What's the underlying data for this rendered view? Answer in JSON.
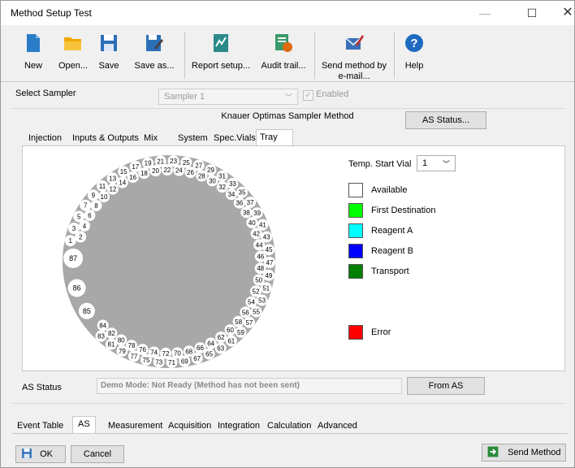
{
  "window": {
    "title": "Method Setup Test",
    "minimize": "—",
    "maximize": "☐",
    "close": "✕"
  },
  "toolbar": {
    "new": "New",
    "open": "Open...",
    "save": "Save",
    "save_as": "Save as...",
    "report_setup": "Report setup...",
    "audit_trail": "Audit trail...",
    "send_email": "Send method by e-mail...",
    "help": "Help"
  },
  "sampler": {
    "label": "Select Sampler",
    "value": "Sampler 1",
    "enabled_label": "Enabled"
  },
  "method_title": "Knauer Optimas Sampler Method",
  "as_status_button": "AS Status...",
  "tabs": [
    "Injection",
    "Inputs & Outputs",
    "Mix",
    "System",
    "Spec.Vials",
    "Tray"
  ],
  "tray": {
    "temp_start_label": "Temp. Start Vial",
    "temp_start_value": "1",
    "legend": [
      {
        "label": "Available",
        "color": "#ffffff"
      },
      {
        "label": "First Destination",
        "color": "#00ff00"
      },
      {
        "label": "Reagent A",
        "color": "#00ffff"
      },
      {
        "label": "Reagent B",
        "color": "#0000ff"
      },
      {
        "label": "Transport",
        "color": "#007f00"
      },
      {
        "label": "Error",
        "color": "#ff0000"
      }
    ],
    "vials": [
      "1",
      "2",
      "3",
      "4",
      "5",
      "6",
      "7",
      "8",
      "9",
      "10",
      "11",
      "12",
      "13",
      "14",
      "15",
      "16",
      "17",
      "18",
      "19",
      "20",
      "21",
      "22",
      "23",
      "24",
      "25",
      "26",
      "27",
      "28",
      "29",
      "30",
      "31",
      "32",
      "33",
      "34",
      "35",
      "36",
      "37",
      "38",
      "39",
      "40",
      "41",
      "42",
      "43",
      "44",
      "45",
      "46",
      "47",
      "48",
      "49",
      "50",
      "51",
      "52",
      "53",
      "54",
      "55",
      "56",
      "57",
      "58",
      "59",
      "60",
      "61",
      "62",
      "63",
      "64",
      "65",
      "66",
      "67",
      "68",
      "69",
      "70",
      "71",
      "72",
      "73",
      "74",
      "75",
      "76",
      "77",
      "78",
      "79",
      "80",
      "81",
      "82",
      "83",
      "84",
      "85",
      "86",
      "87"
    ]
  },
  "status": {
    "label": "AS Status",
    "text": "Demo Mode: Not Ready (Method has not been sent)",
    "from_as": "From AS"
  },
  "bottom_tabs": [
    "Event Table",
    "AS",
    "Measurement",
    "Acquisition",
    "Integration",
    "Calculation",
    "Advanced"
  ],
  "footer": {
    "ok": "OK",
    "cancel": "Cancel",
    "send_method": "Send Method"
  }
}
